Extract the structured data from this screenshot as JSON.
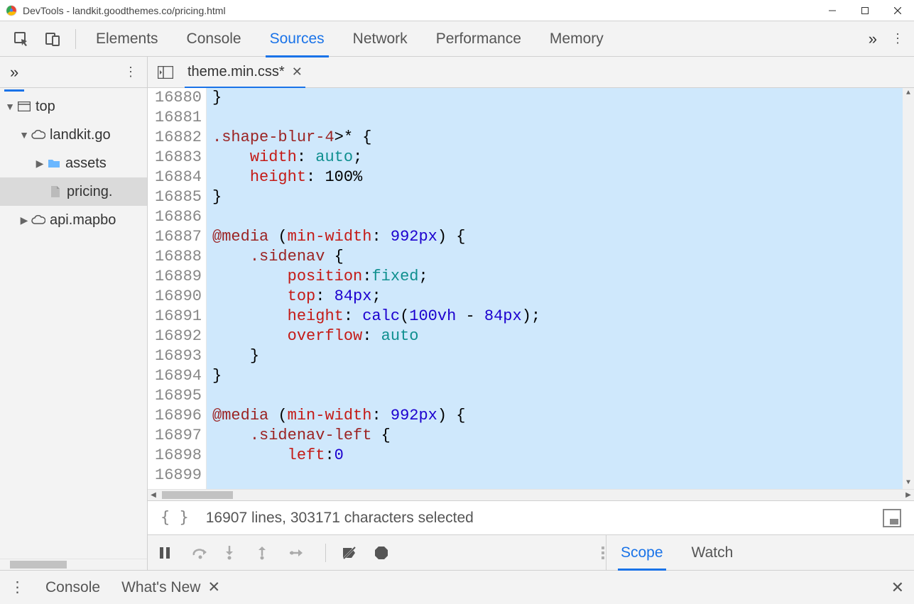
{
  "window": {
    "title": "DevTools - landkit.goodthemes.co/pricing.html"
  },
  "topTabs": [
    "Elements",
    "Console",
    "Sources",
    "Network",
    "Performance",
    "Memory"
  ],
  "topTabsActive": "Sources",
  "fileTree": {
    "top": "top",
    "domain1": "landkit.goodthemes.co",
    "assets": "assets",
    "pricing": "pricing.html",
    "domain2": "api.mapbox.com"
  },
  "editor": {
    "filename": "theme.min.css*",
    "startLine": 16880,
    "lines": [
      "}",
      "",
      ".shape-blur-4>* {",
      "    width: auto;",
      "    height: 100%",
      "}",
      "",
      "@media (min-width: 992px) {",
      "    .sidenav {",
      "        position:fixed;",
      "        top: 84px;",
      "        height: calc(100vh - 84px);",
      "        overflow: auto",
      "    }",
      "}",
      "",
      "@media (min-width: 992px) {",
      "    .sidenav-left {",
      "        left:0",
      ""
    ]
  },
  "status": "16907 lines, 303171 characters selected",
  "debugTabs": {
    "scope": "Scope",
    "watch": "Watch"
  },
  "drawer": {
    "console": "Console",
    "whatsnew": "What's New"
  }
}
